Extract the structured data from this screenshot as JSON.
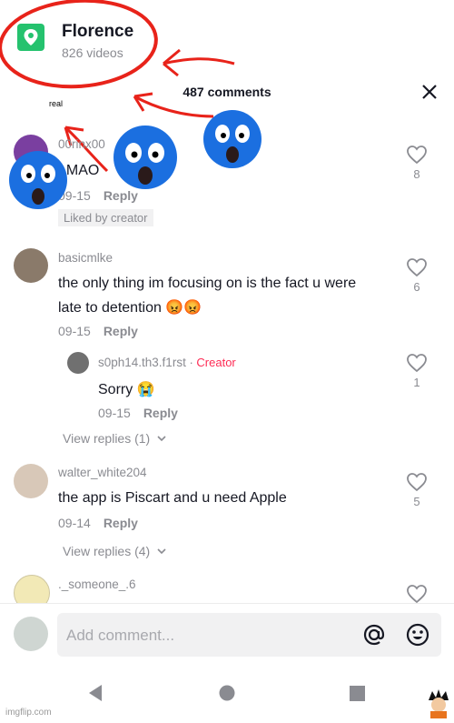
{
  "header": {
    "location_name": "Florence",
    "location_sub": "826 videos",
    "comments_title": "487 comments",
    "annotation": "real"
  },
  "comments": [
    {
      "username": "00rinx00",
      "text": "LMAO",
      "date": "09-15",
      "reply_label": "Reply",
      "likes": "8",
      "badge": "Liked by creator"
    },
    {
      "username": "basicmlke",
      "text_line1": "the only thing im focusing on is the fact u were",
      "text_line2": "late to detention 😡😡",
      "date": "09-15",
      "reply_label": "Reply",
      "likes": "6"
    },
    {
      "username": "s0ph14.th3.f1rst",
      "creator_tag": "Creator",
      "text": "Sorry 😭",
      "date": "09-15",
      "reply_label": "Reply",
      "likes": "1",
      "view_replies": "View replies (1)"
    },
    {
      "username": "walter_white204",
      "text": "the app is Piscart and u need Apple",
      "date": "09-14",
      "reply_label": "Reply",
      "likes": "5",
      "view_replies": "View replies (4)"
    },
    {
      "username": "._someone_.6"
    }
  ],
  "composer": {
    "placeholder": "Add comment..."
  },
  "watermark": "imgflip.com",
  "colors": {
    "accent_red": "#fe2c55",
    "location_green": "#25c26e",
    "annotation_red": "#e8231a",
    "emoji_blue": "#1b6fe0"
  },
  "icons": [
    "location-pin-icon",
    "close-icon",
    "heart-icon",
    "chevron-down-icon",
    "at-icon",
    "emoji-icon",
    "back-icon",
    "home-icon",
    "recents-icon"
  ]
}
